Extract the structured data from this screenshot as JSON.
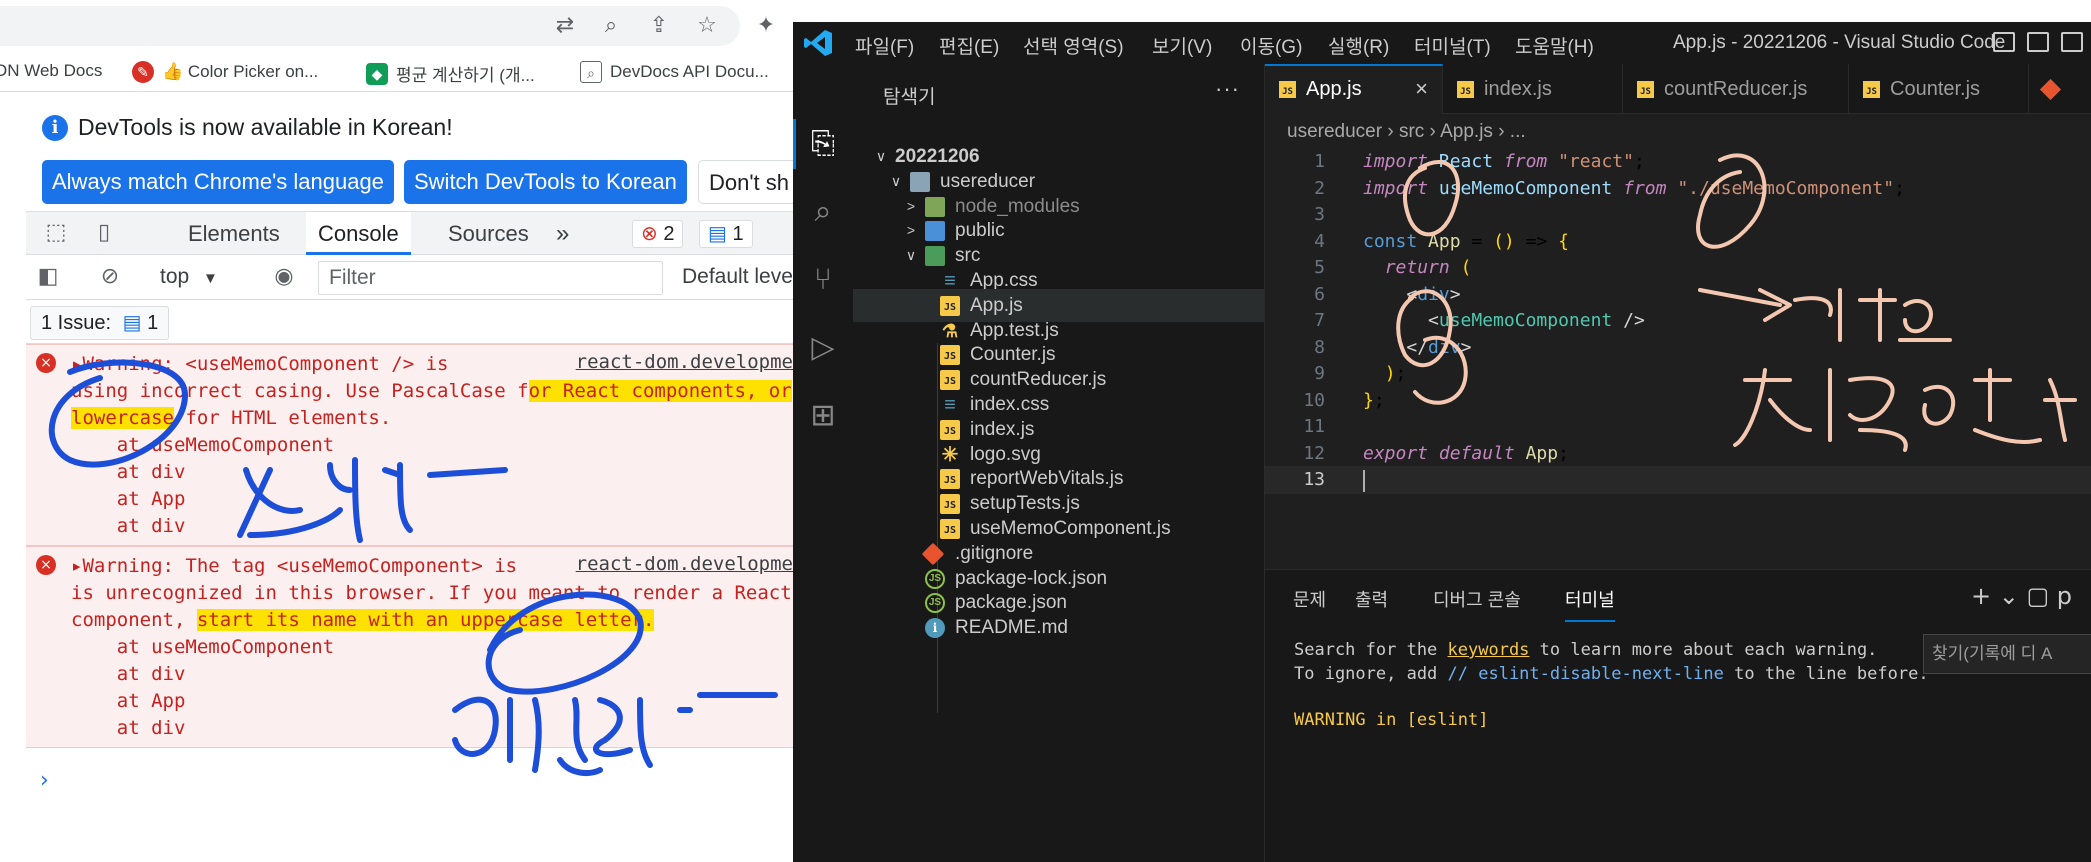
{
  "chrome": {
    "bookmarks": [
      {
        "label": "ON Web Docs",
        "icon": "mdn-icon",
        "color": "#3c4043"
      },
      {
        "label": "👍 Color Picker on...",
        "icon": "color-picker-icon",
        "color": "#d93025"
      },
      {
        "label": "평균 계산하기 (개...",
        "icon": "calculator-site-icon",
        "color": "#0f9d58"
      },
      {
        "label": "DevDocs API Docu...",
        "icon": "devdocs-icon",
        "color": "#5f6368"
      }
    ],
    "toolbar_icons": [
      "translate-icon",
      "zoom-icon",
      "share-icon",
      "bookmark-star-icon",
      "extensions-icon"
    ]
  },
  "devtools": {
    "info_message": "DevTools is now available in Korean!",
    "btn_match": "Always match Chrome's language",
    "btn_switch": "Switch DevTools to Korean",
    "btn_dont": "Don't sh",
    "tabs": [
      "Elements",
      "Console",
      "Sources"
    ],
    "more_tabs": "»",
    "error_count": "2",
    "message_count": "1",
    "context": "top",
    "filter_placeholder": "Filter",
    "levels": "Default leve",
    "issues_label": "1 Issue:",
    "issues_count": "1",
    "logs": [
      {
        "source": "react-dom.developme",
        "lines": [
          "▸Warning: <useMemoComponent /> is",
          "using incorrect casing. Use PascalCase for React components, or",
          "lowercase for HTML elements.",
          "    at useMemoComponent",
          "    at div",
          "    at App",
          "    at div"
        ]
      },
      {
        "source": "react-dom.developme",
        "lines": [
          "▸Warning: The tag <useMemoComponent> is",
          "is unrecognized in this browser. If you meant to render a React",
          "component, start its name with an uppercase letter.",
          "    at useMemoComponent",
          "    at div",
          "    at App",
          "    at div"
        ]
      }
    ],
    "prompt": "›"
  },
  "vscode": {
    "menus": [
      "파일(F)",
      "편집(E)",
      "선택 영역(S)",
      "보기(V)",
      "이동(G)",
      "실행(R)",
      "터미널(T)",
      "도움말(H)"
    ],
    "window_title": "App.js - 20221206 - Visual Studio Code",
    "explorer_title": "탐색기",
    "explorer_more": "···",
    "tree": [
      {
        "label": "20221206",
        "depth": 0,
        "chev": "∨",
        "icon": "",
        "bold": true
      },
      {
        "label": "usereducer",
        "depth": 1,
        "chev": "∨",
        "icon": "folder"
      },
      {
        "label": "node_modules",
        "depth": 2,
        "chev": ">",
        "icon": "folder-green",
        "dim": true
      },
      {
        "label": "public",
        "depth": 2,
        "chev": ">",
        "icon": "folder-blue"
      },
      {
        "label": "src",
        "depth": 2,
        "chev": "∨",
        "icon": "folder-src"
      },
      {
        "label": "App.css",
        "depth": 3,
        "icon": "css"
      },
      {
        "label": "App.js",
        "depth": 3,
        "icon": "js",
        "selected": true
      },
      {
        "label": "App.test.js",
        "depth": 3,
        "icon": "test"
      },
      {
        "label": "Counter.js",
        "depth": 3,
        "icon": "js"
      },
      {
        "label": "countReducer.js",
        "depth": 3,
        "icon": "js"
      },
      {
        "label": "index.css",
        "depth": 3,
        "icon": "css"
      },
      {
        "label": "index.js",
        "depth": 3,
        "icon": "js"
      },
      {
        "label": "logo.svg",
        "depth": 3,
        "icon": "svg"
      },
      {
        "label": "reportWebVitals.js",
        "depth": 3,
        "icon": "js"
      },
      {
        "label": "setupTests.js",
        "depth": 3,
        "icon": "js"
      },
      {
        "label": "useMemoComponent.js",
        "depth": 3,
        "icon": "js"
      },
      {
        "label": ".gitignore",
        "depth": 2,
        "icon": "git"
      },
      {
        "label": "package-lock.json",
        "depth": 2,
        "icon": "json"
      },
      {
        "label": "package.json",
        "depth": 2,
        "icon": "json"
      },
      {
        "label": "README.md",
        "depth": 2,
        "icon": "info"
      }
    ],
    "tabs": [
      "App.js",
      "index.js",
      "countReducer.js",
      "Counter.js"
    ],
    "tab_close": "×",
    "breadcrumb": "usereducer  ›  src  ›  App.js  ›  ...",
    "code": [
      {
        "n": "1",
        "t": "import React from \"react\";"
      },
      {
        "n": "2",
        "t": "import useMemoComponent from \"./useMemoComponent\";"
      },
      {
        "n": "3",
        "t": ""
      },
      {
        "n": "4",
        "t": "const App = () => {"
      },
      {
        "n": "5",
        "t": "  return ("
      },
      {
        "n": "6",
        "t": "    <div>"
      },
      {
        "n": "7",
        "t": "      <useMemoComponent />"
      },
      {
        "n": "8",
        "t": "    </div>"
      },
      {
        "n": "9",
        "t": "  );"
      },
      {
        "n": "10",
        "t": "};"
      },
      {
        "n": "11",
        "t": ""
      },
      {
        "n": "12",
        "t": "export default App;"
      },
      {
        "n": "13",
        "t": ""
      }
    ],
    "panel_tabs": [
      "문제",
      "출력",
      "디버그 콘솔",
      "터미널"
    ],
    "panel_actions": "+ ⌄ ▢ p",
    "find_placeholder": "찾기(기록에 디  A",
    "terminal": {
      "l1_a": "Search for the ",
      "l1_link": "keywords",
      "l1_b": " to learn more about each warning.",
      "l2_a": "To ignore, add ",
      "l2_cmt": "// eslint-disable-next-line",
      "l2_b": " to the line before.",
      "l3": "WARNING in [eslint]"
    }
  },
  "annotations": {
    "ink_blue": "#1d4ed8",
    "ink_peach": "#f4c7b0"
  }
}
